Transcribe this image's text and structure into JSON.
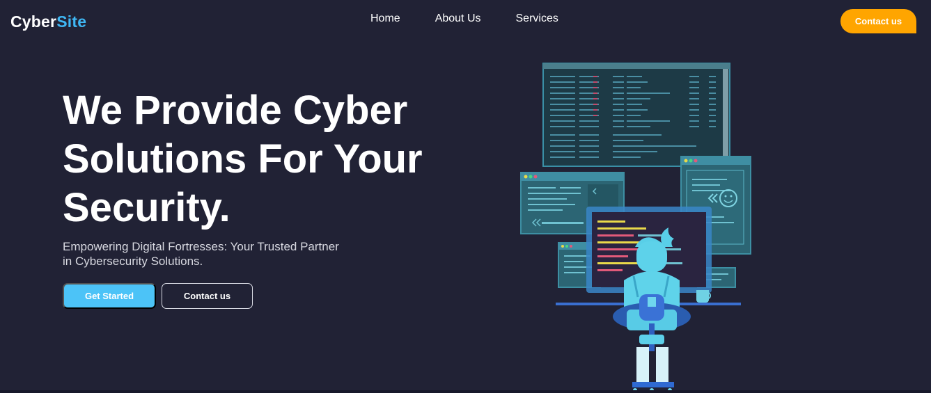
{
  "header": {
    "logo_part1": "Cyber",
    "logo_part2": "Site",
    "nav": [
      "Home",
      "About Us",
      "Services"
    ],
    "cta_label": "Contact us"
  },
  "hero": {
    "title_line1": "We Provide Cyber",
    "title_line2": "Solutions For Your",
    "title_line3": "Security.",
    "subtitle_line1": "Empowering Digital Fortresses: Your Trusted Partner",
    "subtitle_line2": "in Cybersecurity Solutions.",
    "primary_button": "Get Started",
    "secondary_button": "Contact us"
  },
  "colors": {
    "background": "#212235",
    "accent_blue": "#3fb7f4",
    "button_blue": "#4cc3f7",
    "accent_orange": "#ffa500"
  },
  "illustration": {
    "icon": "hacker-at-computer-illustration"
  }
}
